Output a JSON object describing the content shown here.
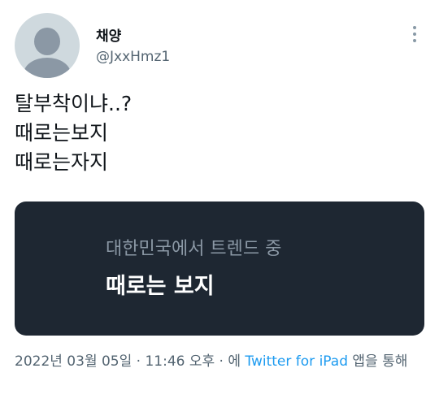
{
  "author": {
    "display_name": "채양",
    "handle": "@JxxHmz1"
  },
  "tweet": {
    "lines": [
      "탈부착이냐..?",
      "때로는보지",
      "때로는자지"
    ]
  },
  "trend_card": {
    "subtitle": "대한민국에서 트렌드 중",
    "title": "때로는 보지"
  },
  "meta": {
    "timestamp": "2022년 03월 05일 · 11:46 오후 · 에",
    "source_link": "Twitter for iPad",
    "suffix": "앱을 통해"
  },
  "colors": {
    "card_bg": "#1e2732",
    "link": "#1d9bf0",
    "secondary_text": "#536471"
  },
  "icons": {
    "more": "more-vertical-icon",
    "avatar": "default-avatar-icon"
  }
}
